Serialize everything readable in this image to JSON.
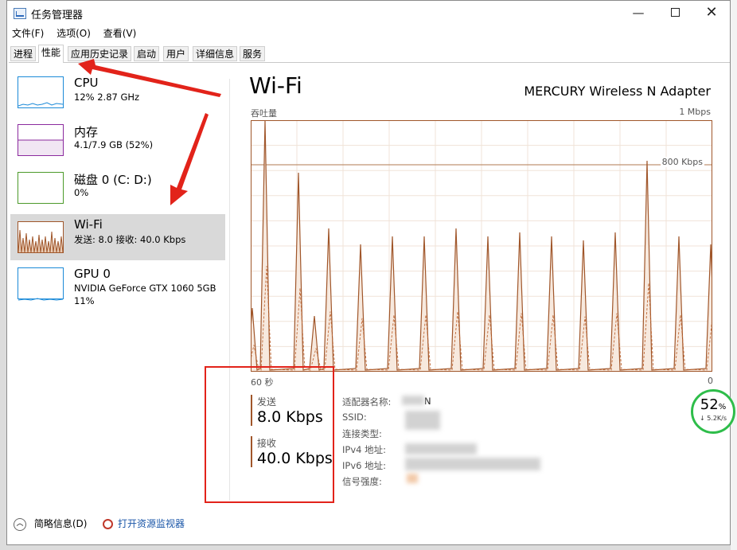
{
  "window": {
    "title": "任务管理器"
  },
  "menu": [
    "文件(F)",
    "选项(O)",
    "查看(V)"
  ],
  "tabs": [
    "进程",
    "性能",
    "应用历史记录",
    "启动",
    "用户",
    "详细信息",
    "服务"
  ],
  "active_tab": "性能",
  "sidebar": {
    "items": [
      {
        "title": "CPU",
        "sub": "12% 2.87 GHz",
        "sub2": ""
      },
      {
        "title": "内存",
        "sub": "4.1/7.9 GB (52%)",
        "sub2": ""
      },
      {
        "title": "磁盘 0 (C: D:)",
        "sub": "0%",
        "sub2": ""
      },
      {
        "title": "Wi-Fi",
        "sub": "发送: 8.0 接收: 40.0 Kbps",
        "sub2": ""
      },
      {
        "title": "GPU 0",
        "sub": "NVIDIA GeForce GTX 1060 5GB",
        "sub2": "11%"
      }
    ]
  },
  "main": {
    "title": "Wi-Fi",
    "adapter": "MERCURY Wireless N Adapter",
    "throughput_label": "吞吐量",
    "max_label": "1 Mbps",
    "ref_line_label": "800 Kbps",
    "time_left": "60 秒",
    "time_right": "0",
    "send_label": "发送",
    "send_value": "8.0 Kbps",
    "recv_label": "接收",
    "recv_value": "40.0 Kbps",
    "info_labels": [
      "适配器名称:",
      "SSID:",
      "连接类型:",
      "IPv4 地址:",
      "IPv6 地址:",
      "信号强度:"
    ],
    "info_values_visible": [
      "N"
    ]
  },
  "footer": {
    "summary": "简略信息(D)",
    "monitor": "打开资源监视器"
  },
  "widget": {
    "percent": "52",
    "percent_unit": "%",
    "speed": "↓ 5.2K/s"
  },
  "colors": {
    "accent": "#a0562a",
    "highlight": "#e2231a",
    "ring": "#2ebd4a"
  }
}
